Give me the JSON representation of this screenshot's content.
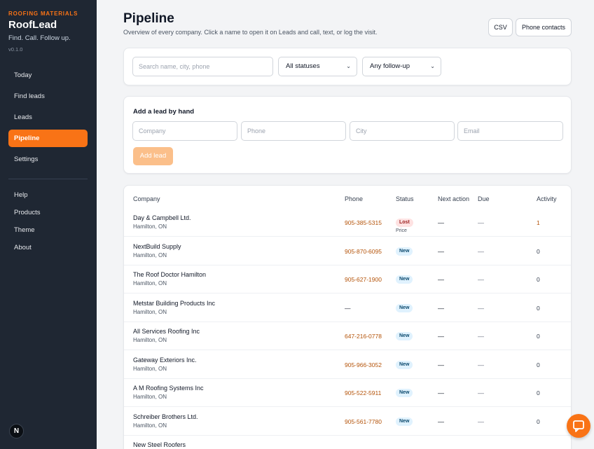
{
  "brand": {
    "eyebrow": "ROOFING MATERIALS",
    "name": "RoofLead",
    "tagline": "Find. Call. Follow up.",
    "version": "v0.1.0"
  },
  "nav": {
    "primary": [
      "Today",
      "Find leads",
      "Leads",
      "Pipeline",
      "Settings"
    ],
    "active": "Pipeline",
    "secondary": [
      "Help",
      "Products",
      "Theme",
      "About"
    ]
  },
  "footer_badge": "N",
  "page": {
    "title": "Pipeline",
    "subtitle": "Overview of every company. Click a name to open it on Leads and call, text, or log the visit."
  },
  "header_buttons": {
    "csv": "CSV",
    "phone_contacts": "Phone contacts"
  },
  "filters": {
    "search_placeholder": "Search name, city, phone",
    "status": "All statuses",
    "followup": "Any follow-up"
  },
  "add_lead": {
    "heading": "Add a lead by hand",
    "company_placeholder": "Company",
    "phone_placeholder": "Phone",
    "city_placeholder": "City",
    "email_placeholder": "Email",
    "button": "Add lead"
  },
  "table": {
    "columns": [
      "Company",
      "Phone",
      "Status",
      "Next action",
      "Due",
      "Activity"
    ],
    "rows": [
      {
        "company": "Day & Campbell Ltd.",
        "city": "Hamilton, ON",
        "phone": "905-385-5315",
        "status": "Lost",
        "status_note": "Price",
        "next": "—",
        "due": "—",
        "activity": "1"
      },
      {
        "company": "NextBuild Supply",
        "city": "Hamilton, ON",
        "phone": "905-870-6095",
        "status": "New",
        "status_note": "",
        "next": "—",
        "due": "—",
        "activity": "0"
      },
      {
        "company": "The Roof Doctor Hamilton",
        "city": "Hamilton, ON",
        "phone": "905-627-1900",
        "status": "New",
        "status_note": "",
        "next": "—",
        "due": "—",
        "activity": "0"
      },
      {
        "company": "Metstar Building Products Inc",
        "city": "Hamilton, ON",
        "phone": "—",
        "status": "New",
        "status_note": "",
        "next": "—",
        "due": "—",
        "activity": "0"
      },
      {
        "company": "All Services Roofing Inc",
        "city": "Hamilton, ON",
        "phone": "647-216-0778",
        "status": "New",
        "status_note": "",
        "next": "—",
        "due": "—",
        "activity": "0"
      },
      {
        "company": "Gateway Exteriors Inc.",
        "city": "Hamilton, ON",
        "phone": "905-966-3052",
        "status": "New",
        "status_note": "",
        "next": "—",
        "due": "—",
        "activity": "0"
      },
      {
        "company": "A M Roofing Systems Inc",
        "city": "Hamilton, ON",
        "phone": "905-522-5911",
        "status": "New",
        "status_note": "",
        "next": "—",
        "due": "—",
        "activity": "0"
      },
      {
        "company": "Schreiber Brothers Ltd.",
        "city": "Hamilton, ON",
        "phone": "905-561-7780",
        "status": "New",
        "status_note": "",
        "next": "—",
        "due": "—",
        "activity": "0"
      },
      {
        "company": "New Steel Roofers",
        "city": "",
        "phone": "",
        "status": "",
        "status_note": "",
        "next": "",
        "due": "",
        "activity": ""
      }
    ]
  },
  "colors": {
    "accent": "#f97316",
    "sidebar_bg": "#1f2733",
    "phone_link": "#b45309",
    "badge_new_bg": "#e0f2fe",
    "badge_lost_bg": "#fee2e2"
  },
  "icons": {
    "chat": "chat-bubble-icon",
    "chevron": "chevron-down-icon"
  }
}
